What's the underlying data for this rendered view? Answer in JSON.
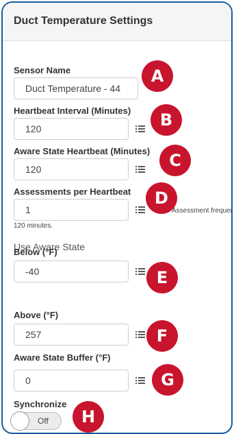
{
  "panel": {
    "title": "Duct Temperature Settings"
  },
  "fields": [
    {
      "label": "Sensor Name",
      "value": "Duct Temperature - 44"
    },
    {
      "label": "Heartbeat Interval (Minutes)",
      "value": "120"
    },
    {
      "label": "Aware State Heartbeat (Minutes)",
      "value": "120"
    },
    {
      "label": "Assessments per Heartbeat",
      "value": "1"
    },
    {
      "label": "Below (°F)",
      "value": "-40"
    },
    {
      "label": "Above (°F)",
      "value": "257"
    },
    {
      "label": "Aware State Buffer (°F)",
      "value": "0"
    }
  ],
  "assessment_note": {
    "frequency_text": "Assessment frequency",
    "minutes_text": "120 minutes."
  },
  "aware_state_heading": "Use Aware State",
  "synchronize": {
    "label": "Synchronize",
    "state": "Off"
  },
  "badges": [
    "A",
    "B",
    "C",
    "D",
    "E",
    "F",
    "G",
    "H"
  ],
  "colors": {
    "border": "#1a5c9e",
    "badge": "#c8152d"
  }
}
